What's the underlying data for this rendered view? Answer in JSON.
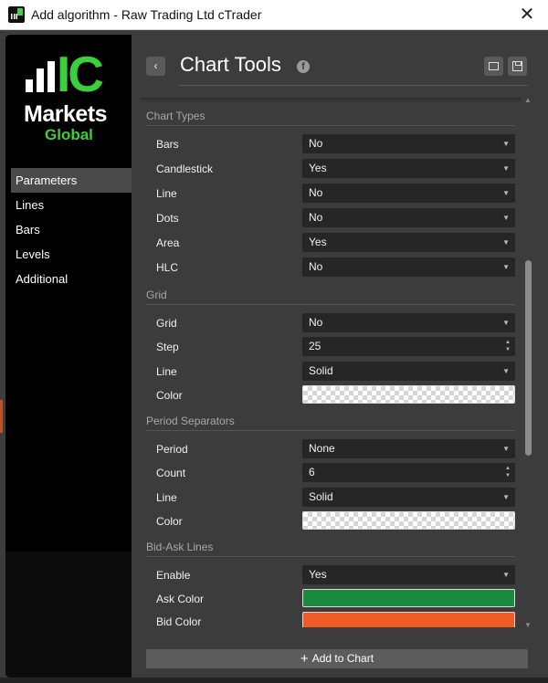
{
  "window": {
    "title": "Add algorithm - Raw Trading Ltd cTrader",
    "close_glyph": "✕",
    "app_icon": "ic-markets-app-icon"
  },
  "logo": {
    "letters": "IC",
    "line1": "Markets",
    "line2": "Global",
    "brand_green": "#3bcf3b"
  },
  "nav": {
    "items": [
      {
        "label": "Parameters",
        "active": true
      },
      {
        "label": "Lines",
        "active": false
      },
      {
        "label": "Bars",
        "active": false
      },
      {
        "label": "Levels",
        "active": false
      },
      {
        "label": "Additional",
        "active": false
      }
    ]
  },
  "header": {
    "title": "Chart Tools",
    "back_glyph": "‹",
    "facebook_glyph": "f",
    "icons": [
      "back-arrow-icon",
      "facebook-icon",
      "load-preset-icon",
      "save-preset-icon"
    ]
  },
  "sections": {
    "chart_types": {
      "title": "Chart Types",
      "rows": [
        {
          "label": "Bars",
          "value": "No"
        },
        {
          "label": "Candlestick",
          "value": "Yes"
        },
        {
          "label": "Line",
          "value": "No"
        },
        {
          "label": "Dots",
          "value": "No"
        },
        {
          "label": "Area",
          "value": "Yes"
        },
        {
          "label": "HLC",
          "value": "No"
        }
      ]
    },
    "grid": {
      "title": "Grid",
      "grid": {
        "label": "Grid",
        "value": "No"
      },
      "step": {
        "label": "Step",
        "value": "25"
      },
      "line": {
        "label": "Line",
        "value": "Solid"
      },
      "color": {
        "label": "Color",
        "value": "transparent"
      }
    },
    "period_separators": {
      "title": "Period Separators",
      "period": {
        "label": "Period",
        "value": "None"
      },
      "count": {
        "label": "Count",
        "value": "6"
      },
      "line": {
        "label": "Line",
        "value": "Solid"
      },
      "color": {
        "label": "Color",
        "value": "transparent"
      }
    },
    "bid_ask_lines": {
      "title": "Bid-Ask Lines",
      "enable": {
        "label": "Enable",
        "value": "Yes"
      },
      "ask_color": {
        "label": "Ask Color",
        "value": "#1b8a3e"
      },
      "bid_color": {
        "label": "Bid Color",
        "value": "#f05a24"
      }
    }
  },
  "glyphs": {
    "dropdown": "▼",
    "spin_up": "▲",
    "spin_down": "▼",
    "scroll_up": "▲",
    "scroll_down": "▼",
    "plus": "+"
  },
  "footer": {
    "add_label": "Add to Chart"
  },
  "colors": {
    "accent_green": "#3bcf3b",
    "panel_bg": "#3c3c3c",
    "field_bg": "#262626"
  }
}
